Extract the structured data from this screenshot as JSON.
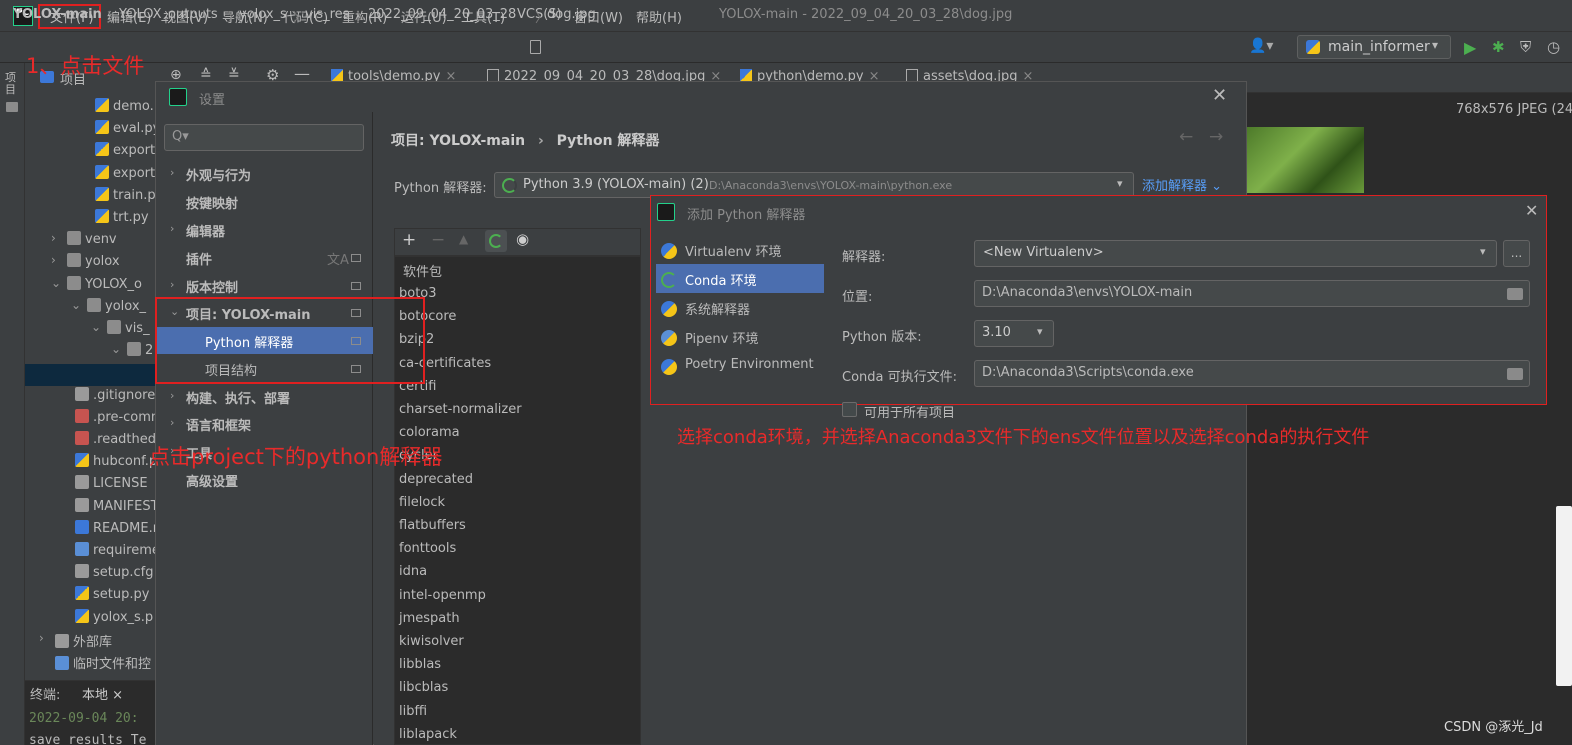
{
  "menubar": {
    "items": [
      "文件(F)",
      "编辑(E)",
      "视图(V)",
      "导航(N)",
      "代码(C)",
      "重构(R)",
      "运行(U)",
      "工具(T)",
      "VCS(S)",
      "窗口(W)",
      "帮助(H)"
    ],
    "window_title": "YOLOX-main - 2022_09_04_20_03_28\\dog.jpg"
  },
  "breadcrumb": [
    "YOLOX-main",
    "YOLOX_outputs",
    "yolox_s",
    "vis_res",
    "2022_09_04_20_03_28",
    "dog.jpg"
  ],
  "run_config": "main_informer",
  "project_panel": {
    "strip_label": "项目",
    "header": "项目",
    "tree": [
      {
        "label": "demo.",
        "indent": 70,
        "icon": "python-file-icon"
      },
      {
        "label": "eval.py",
        "indent": 70,
        "icon": "python-file-icon"
      },
      {
        "label": "export",
        "indent": 70,
        "icon": "python-file-icon"
      },
      {
        "label": "export",
        "indent": 70,
        "icon": "python-file-icon"
      },
      {
        "label": "train.p",
        "indent": 70,
        "icon": "python-file-icon"
      },
      {
        "label": "trt.py",
        "indent": 70,
        "icon": "python-file-icon"
      },
      {
        "label": "venv",
        "indent": 42,
        "icon": "folder-icon",
        "arrow": "›"
      },
      {
        "label": "yolox",
        "indent": 42,
        "icon": "folder-icon",
        "arrow": "›"
      },
      {
        "label": "YOLOX_o",
        "indent": 42,
        "icon": "folder-icon",
        "arrow": "⌄"
      },
      {
        "label": "yolox_",
        "indent": 62,
        "icon": "folder-icon",
        "arrow": "⌄"
      },
      {
        "label": "vis_",
        "indent": 82,
        "icon": "folder-icon",
        "arrow": "⌄"
      },
      {
        "label": "2",
        "indent": 102,
        "icon": "folder-icon",
        "arrow": "⌄"
      },
      {
        "label": "",
        "indent": 120,
        "icon": "",
        "selected": true
      },
      {
        "label": ".gitignore",
        "indent": 50,
        "icon": "text-file-icon"
      },
      {
        "label": ".pre-comm",
        "indent": 50,
        "icon": "yml-file-icon"
      },
      {
        "label": ".readthed",
        "indent": 50,
        "icon": "yml-file-icon"
      },
      {
        "label": "hubconf.p",
        "indent": 50,
        "icon": "python-file-icon"
      },
      {
        "label": "LICENSE",
        "indent": 50,
        "icon": "text-file-icon"
      },
      {
        "label": "MANIFEST",
        "indent": 50,
        "icon": "text-file-icon"
      },
      {
        "label": "README.r",
        "indent": 50,
        "icon": "md-file-icon"
      },
      {
        "label": "requireme",
        "indent": 50,
        "icon": "requirements-file-icon"
      },
      {
        "label": "setup.cfg",
        "indent": 50,
        "icon": "config-file-icon"
      },
      {
        "label": "setup.py",
        "indent": 50,
        "icon": "python-file-icon"
      },
      {
        "label": "yolox_s.p",
        "indent": 50,
        "icon": "python-file-icon"
      },
      {
        "label": "外部库",
        "indent": 30,
        "icon": "library-icon",
        "arrow": "›"
      },
      {
        "label": "临时文件和控",
        "indent": 30,
        "icon": "scratch-icon"
      }
    ]
  },
  "editor_tabs": [
    "tools\\demo.py",
    "2022_09_04_20_03_28\\dog.jpg",
    "python\\demo.py",
    "assets\\dog.jpg"
  ],
  "image_info": "768x576 JPEG (24",
  "terminal": {
    "label": "终端:",
    "tab": "本地",
    "line1": "2022-09-04 20:",
    "line2": "save_results_Te"
  },
  "settings": {
    "title": "设置",
    "search_placeholder": "Q▾",
    "nav": [
      {
        "label": "外观与行为",
        "arrow": "›"
      },
      {
        "label": "按键映射",
        "arrow": ""
      },
      {
        "label": "编辑器",
        "arrow": "›"
      },
      {
        "label": "插件",
        "arrow": ""
      },
      {
        "label": "版本控制",
        "arrow": "›"
      },
      {
        "label": "项目: YOLOX-main",
        "arrow": "⌄"
      },
      {
        "label": "Python 解释器",
        "arrow": "",
        "sub": true,
        "selected": true
      },
      {
        "label": "项目结构",
        "arrow": "",
        "sub": true
      },
      {
        "label": "构建、执行、部署",
        "arrow": "›"
      },
      {
        "label": "语言和框架",
        "arrow": "›"
      },
      {
        "label": "工具",
        "arrow": "›"
      },
      {
        "label": "高级设置",
        "arrow": ""
      }
    ],
    "breadcrumb_project": "项目: YOLOX-main",
    "breadcrumb_page": "Python 解释器",
    "interpreter_label": "Python 解释器:",
    "interpreter_value": "Python 3.9 (YOLOX-main) (2)",
    "interpreter_path": "D:\\Anaconda3\\envs\\YOLOX-main\\python.exe",
    "add_interpreter": "添加解释器",
    "packages_header": "软件包",
    "packages": [
      "boto3",
      "botocore",
      "bzip2",
      "ca-certificates",
      "certifi",
      "charset-normalizer",
      "colorama",
      "cycler",
      "deprecated",
      "filelock",
      "flatbuffers",
      "fonttools",
      "idna",
      "intel-openmp",
      "jmespath",
      "kiwisolver",
      "libblas",
      "libcblas",
      "libffi",
      "liblapack"
    ]
  },
  "add_interpreter_dialog": {
    "title": "添加 Python 解释器",
    "types": [
      {
        "label": "Virtualenv 环境",
        "color": "#3c78d8"
      },
      {
        "label": "Conda 环境",
        "color": "#4caf50",
        "selected": true
      },
      {
        "label": "系统解释器",
        "color": "#3c78d8"
      },
      {
        "label": "Pipenv 环境",
        "color": "#5a8fd6"
      },
      {
        "label": "Poetry Environment",
        "color": "#3c78d8"
      }
    ],
    "interpreter_label": "解释器:",
    "interpreter_value": "<New Virtualenv>",
    "more_button": "...",
    "location_label": "位置:",
    "location_value": "D:\\Anaconda3\\envs\\YOLOX-main",
    "python_version_label": "Python 版本:",
    "python_version_value": "3.10",
    "conda_exe_label": "Conda 可执行文件:",
    "conda_exe_value": "D:\\Anaconda3\\Scripts\\conda.exe",
    "all_projects_label": "可用于所有项目"
  },
  "annotations": {
    "step1": "1、点击文件",
    "step2": "点击project下的python解释器",
    "step3": "选择conda环境，并选择Anaconda3文件下的ens文件位置以及选择conda的执行文件"
  },
  "watermark": "CSDN @涿光_Jd",
  "colors": {
    "accent": "#4b6eaf",
    "annotation": "#e02020",
    "link": "#589df6",
    "run_green": "#4caf50"
  }
}
